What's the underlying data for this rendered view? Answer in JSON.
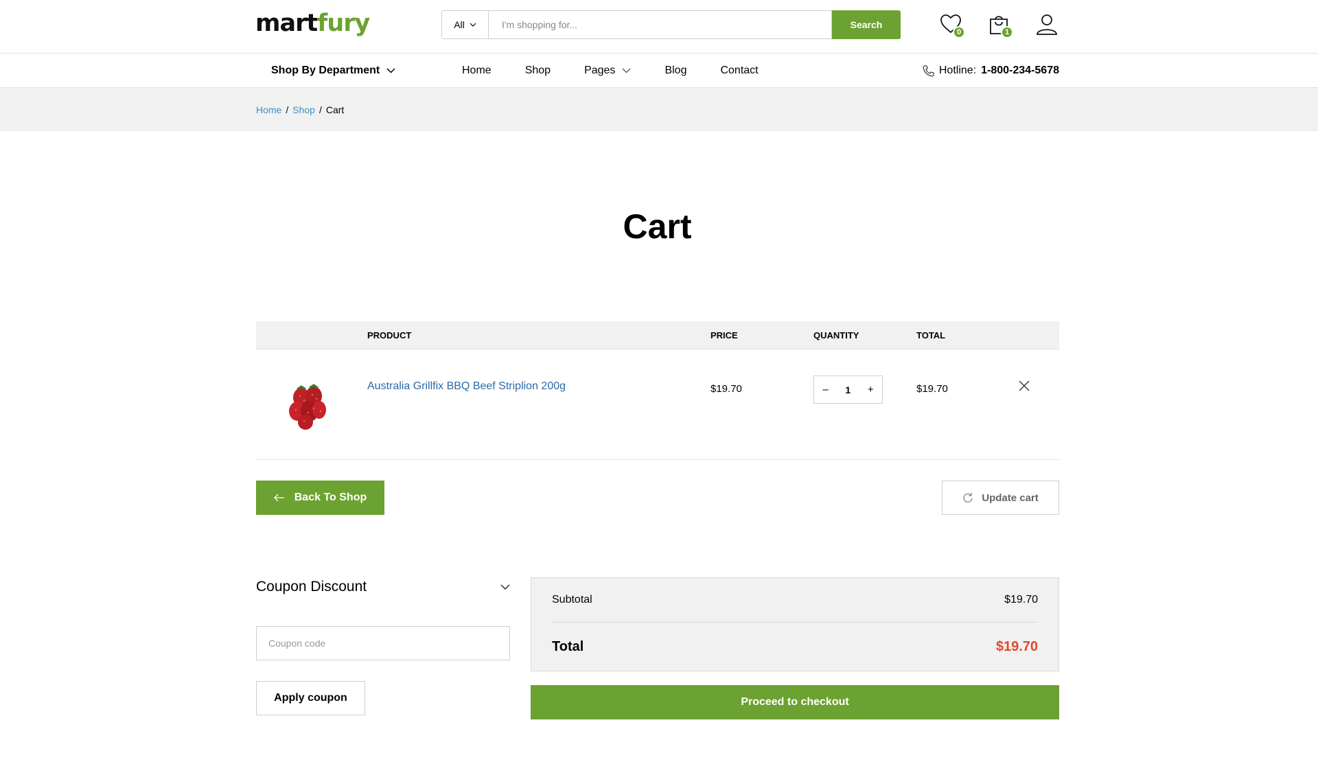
{
  "header": {
    "logo_part1": "mart",
    "logo_part2": "fury",
    "search_category": "All",
    "search_placeholder": "I'm shopping for...",
    "search_button": "Search",
    "wishlist_count": "0",
    "cart_count": "1"
  },
  "nav": {
    "department": "Shop By Department",
    "links": [
      "Home",
      "Shop",
      "Pages",
      "Blog",
      "Contact"
    ],
    "hotline_label": "Hotline:",
    "hotline_number": "1-800-234-5678"
  },
  "breadcrumb": {
    "home": "Home",
    "shop": "Shop",
    "current": "Cart",
    "separator": "/"
  },
  "page_title": "Cart",
  "table": {
    "headers": [
      "PRODUCT",
      "PRICE",
      "QUANTITY",
      "TOTAL"
    ],
    "items": [
      {
        "name": "Australia Grillfix BBQ Beef Striplion 200g",
        "price": "$19.70",
        "quantity": "1",
        "total": "$19.70",
        "minus": "–",
        "plus": "+"
      }
    ]
  },
  "actions": {
    "back_to_shop": "Back To Shop",
    "update_cart": "Update cart"
  },
  "coupon": {
    "title": "Coupon Discount",
    "placeholder": "Coupon code",
    "apply": "Apply coupon"
  },
  "totals": {
    "subtotal_label": "Subtotal",
    "subtotal_value": "$19.70",
    "total_label": "Total",
    "total_value": "$19.70",
    "checkout": "Proceed to checkout"
  },
  "colors": {
    "accent": "#6ca231",
    "link": "#2a6aa8",
    "total_price": "#e04a28"
  }
}
